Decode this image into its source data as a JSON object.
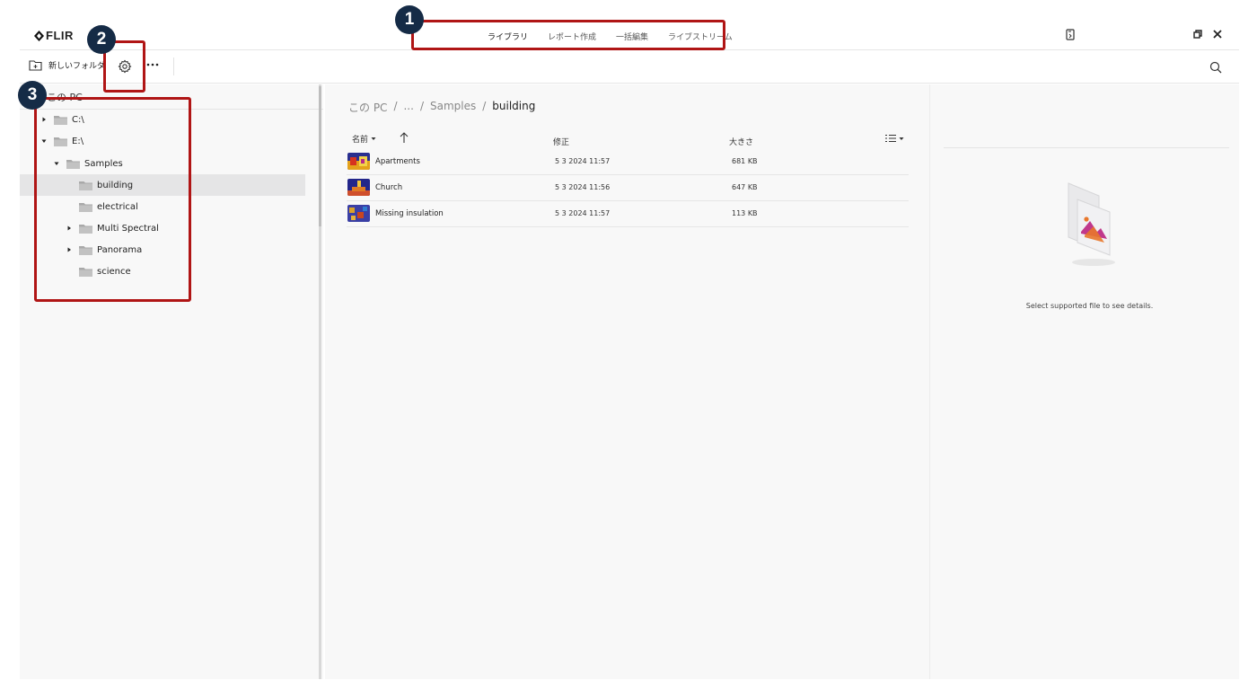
{
  "app": {
    "logo_text": "FLIR"
  },
  "nav": {
    "tabs": [
      {
        "label": "ライブラリ",
        "active": true
      },
      {
        "label": "レポート作成",
        "active": false
      },
      {
        "label": "一括編集",
        "active": false
      },
      {
        "label": "ライブストリーム",
        "active": false
      }
    ]
  },
  "toolbar": {
    "new_folder_label": "新しいフォルダ"
  },
  "tree": {
    "root_label": "この PC",
    "items": [
      {
        "label": "C:\\",
        "expanded": false
      },
      {
        "label": "E:\\",
        "expanded": true
      },
      {
        "label": "Samples",
        "expanded": true
      },
      {
        "label": "building",
        "selected": true
      },
      {
        "label": "electrical"
      },
      {
        "label": "Multi Spectral",
        "expanded": false
      },
      {
        "label": "Panorama",
        "expanded": false
      },
      {
        "label": "science"
      }
    ]
  },
  "breadcrumb": {
    "root": "この PC",
    "ellipsis": "...",
    "parent": "Samples",
    "current": "building",
    "separator": "/"
  },
  "file_list": {
    "columns": {
      "name": "名前",
      "modified": "修正",
      "size": "大きさ"
    },
    "rows": [
      {
        "name": "Apartments",
        "modified": "5 3 2024 11:57",
        "size": "681 KB"
      },
      {
        "name": "Church",
        "modified": "5 3 2024 11:56",
        "size": "647 KB"
      },
      {
        "name": "Missing insulation",
        "modified": "5 3 2024 11:57",
        "size": "113 KB"
      }
    ]
  },
  "details": {
    "message": "Select supported file to see details."
  },
  "annotations": {
    "badge1": "1",
    "badge2": "2",
    "badge3": "3",
    "color": "#b01515",
    "badge_color": "#152b46"
  }
}
